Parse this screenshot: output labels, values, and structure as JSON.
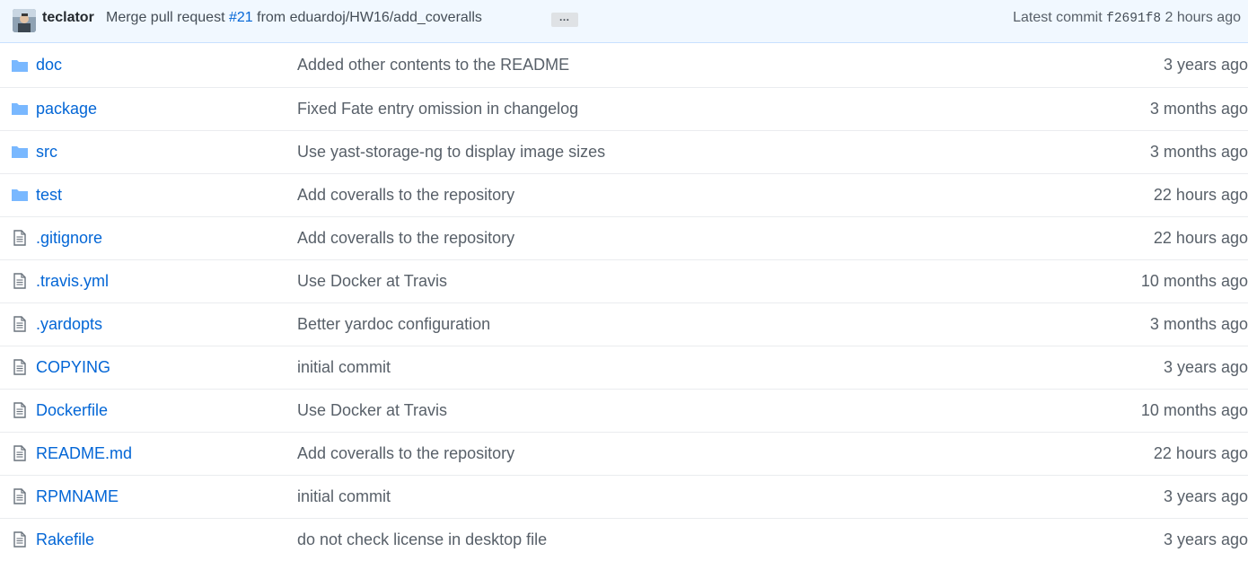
{
  "commit": {
    "author": "teclator",
    "message_prefix": "Merge pull request ",
    "pr_number": "#21",
    "message_suffix": " from eduardoj/HW16/add_coveralls",
    "ellipsis_label": "…",
    "latest_label": "Latest commit ",
    "sha": "f2691f8",
    "age": " 2 hours ago"
  },
  "files": [
    {
      "type": "folder",
      "icon": "folder-icon",
      "name": "doc",
      "message": "Added other contents to the README",
      "age": "3 years ago"
    },
    {
      "type": "folder",
      "icon": "folder-icon",
      "name": "package",
      "message": "Fixed Fate entry omission in changelog",
      "age": "3 months ago"
    },
    {
      "type": "folder",
      "icon": "folder-icon",
      "name": "src",
      "message": "Use yast-storage-ng to display image sizes",
      "age": "3 months ago"
    },
    {
      "type": "folder",
      "icon": "folder-icon",
      "name": "test",
      "message": "Add coveralls to the repository",
      "age": "22 hours ago"
    },
    {
      "type": "file",
      "icon": "file-icon",
      "name": ".gitignore",
      "message": "Add coveralls to the repository",
      "age": "22 hours ago"
    },
    {
      "type": "file",
      "icon": "file-icon",
      "name": ".travis.yml",
      "message": "Use Docker at Travis",
      "age": "10 months ago"
    },
    {
      "type": "file",
      "icon": "file-icon",
      "name": ".yardopts",
      "message": "Better yardoc configuration",
      "age": "3 months ago"
    },
    {
      "type": "file",
      "icon": "file-icon",
      "name": "COPYING",
      "message": "initial commit",
      "age": "3 years ago"
    },
    {
      "type": "file",
      "icon": "file-icon",
      "name": "Dockerfile",
      "message": "Use Docker at Travis",
      "age": "10 months ago"
    },
    {
      "type": "file",
      "icon": "file-icon",
      "name": "README.md",
      "message": "Add coveralls to the repository",
      "age": "22 hours ago"
    },
    {
      "type": "file",
      "icon": "file-icon",
      "name": "RPMNAME",
      "message": "initial commit",
      "age": "3 years ago"
    },
    {
      "type": "file",
      "icon": "file-icon",
      "name": "Rakefile",
      "message": "do not check license in desktop file",
      "age": "3 years ago"
    }
  ],
  "colors": {
    "link": "#0366d6",
    "muted": "#586069",
    "folder_icon": "#79b8ff",
    "file_icon": "#6a737d",
    "commit_bar_bg": "#f1f8ff"
  }
}
